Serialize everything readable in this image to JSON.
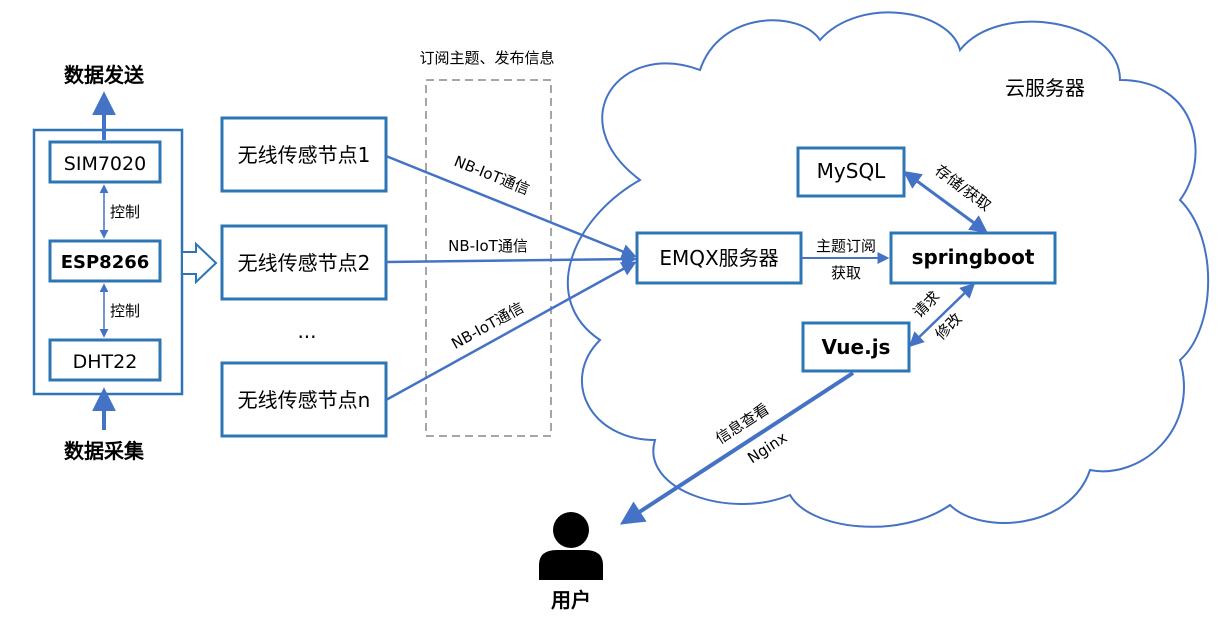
{
  "colors": {
    "line": "#4472C4",
    "box": "#2E75B6",
    "dashed": "#A6A6A6",
    "text": "#000000",
    "user": "#000000"
  },
  "device": {
    "send_label": "数据发送",
    "collect_label": "数据采集",
    "sim_label": "SIM7020",
    "esp_label": "ESP8266",
    "dht_label": "DHT22",
    "control_label_1": "控制",
    "control_label_2": "控制"
  },
  "nodes": {
    "node1": "无线传感节点1",
    "node2": "无线传感节点2",
    "ellipsis": "...",
    "noden": "无线传感节点n"
  },
  "channel": {
    "title": "订阅主题、发布信息",
    "link1": "NB-IoT通信",
    "link2": "NB-IoT通信",
    "link3": "NB-IoT通信"
  },
  "cloud": {
    "title": "云服务器",
    "emqx": "EMQX服务器",
    "springboot": "springboot",
    "mysql": "MySQL",
    "vue": "Vue.js",
    "subscribe_label": "主题订阅",
    "fetch_label": "获取",
    "store_label": "存储/获取",
    "request_label": "请求",
    "modify_label": "修改"
  },
  "user": {
    "icon": "user-icon",
    "label": "用户",
    "info_label": "信息查看",
    "nginx_label": "Nginx"
  }
}
